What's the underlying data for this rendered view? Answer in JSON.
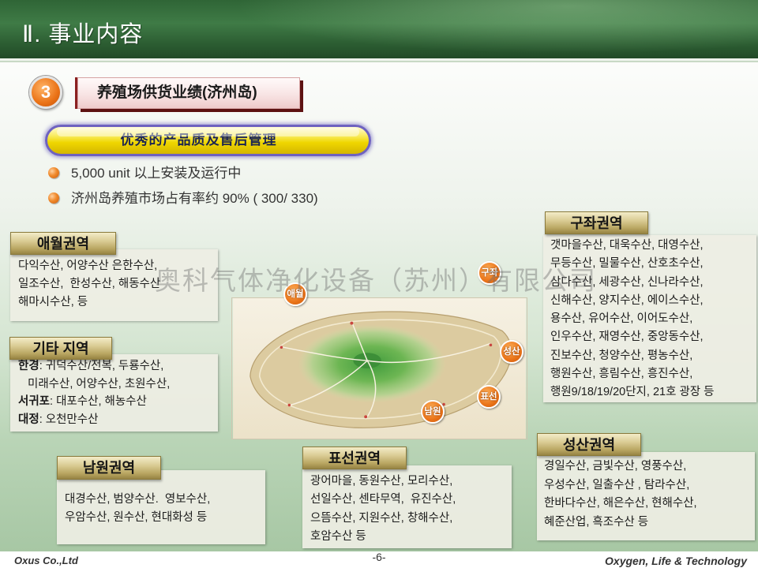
{
  "header": {
    "title": "Ⅱ. 事业内容"
  },
  "section": {
    "number": "3",
    "title": "养殖场供货业绩(济州岛)"
  },
  "highlight": {
    "label": "优秀的产品质及售后管理"
  },
  "bullets": [
    "5,000 unit 以上安装及运行中",
    "济州岛养殖市场占有率约 90% ( 300/ 330)"
  ],
  "watermark": "奥科气体净化设备（苏州）有限公司",
  "map": {
    "markers": {
      "aewol": "애월",
      "gujwa": "구좌",
      "seongsan": "성산",
      "pyoseon": "표선",
      "namwon": "남원"
    }
  },
  "regions": {
    "aewol": {
      "title": "애월권역",
      "lines": [
        "다익수산, 어양수산 은한수산,",
        "일조수산,  한성수산, 해동수산",
        "해마시수산, 등"
      ]
    },
    "other": {
      "title": "기타 지역",
      "lines": [
        {
          "bold": "한경",
          "text": ": 귀덕수산/전복, 두룡수산,"
        },
        {
          "text": "미래수산, 어양수산, 초원수산,"
        },
        {
          "bold": "서귀포",
          "text": ": 대포수산, 해농수산"
        },
        {
          "bold": "대정",
          "text": ": 오천만수산"
        }
      ]
    },
    "namwon": {
      "title": "남원권역",
      "lines": [
        "대경수산, 범양수산.  영보수산,",
        "우암수산, 원수산, 현대화성 등"
      ]
    },
    "pyoseon": {
      "title": "표선권역",
      "lines": [
        "광어마을, 동원수산, 모리수산,",
        "선일수산, 센타무역,  유진수산,",
        "으뜸수산, 지원수산, 창해수산,",
        "호암수산 등"
      ]
    },
    "seongsan": {
      "title": "성산권역",
      "lines": [
        "경일수산, 금빛수산, 영풍수산,",
        "우성수산, 일출수산 , 탐라수산,",
        "한바다수산, 해은수산, 현해수산,",
        "혜준산업, 흑조수산 등"
      ]
    },
    "gujwa": {
      "title": "구좌권역",
      "lines": [
        "갯마을수산, 대욱수산, 대영수산,",
        "무등수산, 밀물수산, 산호초수산,",
        "삼다수산, 세광수산, 신나라수산,",
        "신해수산, 양지수산, 에이스수산,",
        "용수산, 유어수산, 이어도수산,",
        "인우수산, 재영수산, 중앙동수산,",
        "진보수산, 청양수산, 평농수산,",
        "행원수산, 흥림수산, 흥진수산,",
        "행원9/18/19/20단지, 21호 광장 등"
      ]
    }
  },
  "footer": {
    "company": "Oxus Co.,Ltd",
    "page": "-6-",
    "slogan": "Oxygen, Life & Technology"
  },
  "colors": {
    "header_green": "#2f6536",
    "accent_orange": "#ea7419",
    "label_pink": "#f8e4e4",
    "label_shadow_maroon": "#5d1212",
    "highlight_yellow": "#efd600",
    "highlight_border_purple": "#6e62c0",
    "tab_khaki": "#d9cb93"
  }
}
